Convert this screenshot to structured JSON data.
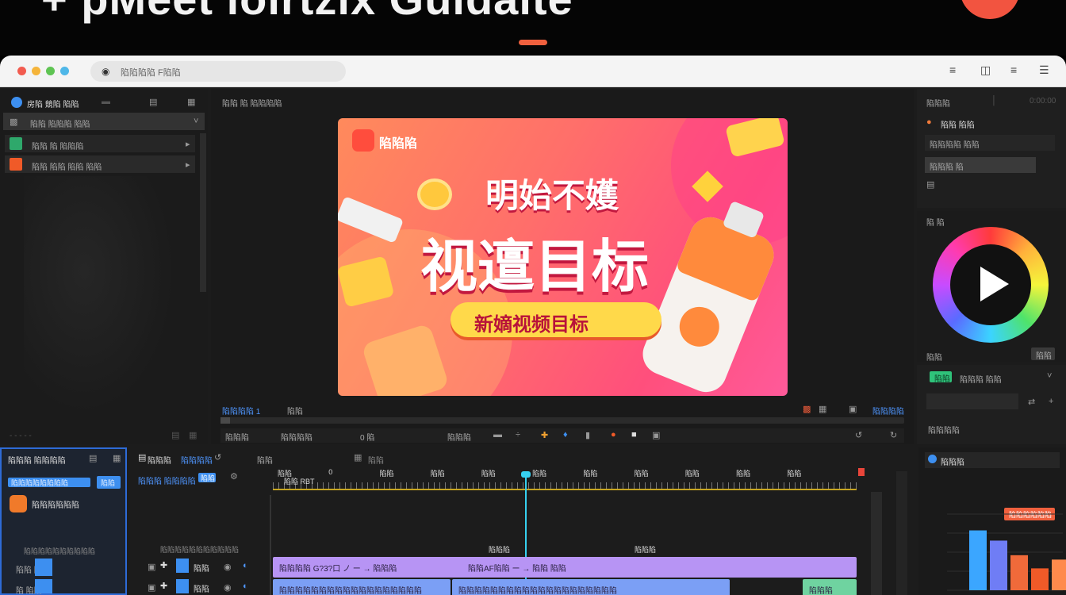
{
  "banner": {
    "title": "+ pMeet ioirtzix Guidaite"
  },
  "browser": {
    "url_text": "陷陷陷陷 F陷陷",
    "toolbar_icons": [
      "sliders-icon",
      "split-view-icon",
      "settings-icon",
      "menu-icon"
    ]
  },
  "media_panel": {
    "title": "房陷 競陷 陷陷",
    "folder_label": "陷陷 陷陷陷 陷陷",
    "items": [
      {
        "label": "陷陷 陷  陷陷陷",
        "color": "#2ea86b"
      },
      {
        "label": "陷陷 陷陷 陷陷 陷陷",
        "color": "#f05a28"
      }
    ],
    "footer": "-  -  -  -  -"
  },
  "viewer": {
    "header": "陷陷 陷 陷陷陷陷",
    "timecode": "陷陷陷陷  1",
    "timecode2": "陷陷",
    "ratio_label": "陷陷陷陷",
    "tools": [
      "陷陷陷",
      "陷陷陷陷",
      "0  陷",
      "陷陷陷"
    ],
    "preview": {
      "badge": "陷陷陷",
      "line1": "明始不嬳",
      "line2": "视邅目标",
      "line3": "新嫡视频目标"
    }
  },
  "inspector": {
    "header": "陷陷陷",
    "item_title": "陷陷 陷陷",
    "field1": "陷陷陷陷 陷陷",
    "field2": "陷陷陷 陷",
    "color_label": "陷 陷",
    "color_footer_left": "陷陷",
    "color_footer_right": "陷陷",
    "audio_tag": "陷陷",
    "audio_label": "陷陷陷 陷陷",
    "audio_footer": "陷陷陷陷"
  },
  "left_bottom": {
    "title": "陷陷陷  陷陷陷陷",
    "button": "陷陷陷陷陷陷陷陷",
    "button2": "陷陷",
    "item": "陷陷陷陷陷陷",
    "section": "陷陷陷陷陷陷陷陷陷陷",
    "row1": "陷陷 陷",
    "row2": "陷 陷陷"
  },
  "timeline": {
    "tabs": [
      "陷陷陷",
      "陷陷陷陷"
    ],
    "controls": "陷陷陷  陷陷陷陷",
    "control_badge": "陷陷",
    "ruler_labels": [
      "陷陷",
      "0",
      "陷陷",
      "陷陷",
      "陷陷",
      "陷陷",
      "陷陷",
      "陷陷",
      "陷陷",
      "陷陷",
      "陷陷"
    ],
    "ruler_sub": "陷陷 RBT",
    "track_label_top": "陷陷陷陷陷陷陷陷陷陷陷",
    "track1_name": "陷陷",
    "track2_name": "陷陷",
    "clip_top_label": "陷陷陷",
    "clip_top_label2": "陷陷陷",
    "clip_a": "陷陷陷陷 G?3?口 ノ ー → 陷陷陷",
    "clip_b": "陷陷AF陷陷 ー → 陷陷 陷陷",
    "clip_c": "陷陷陷陷陷陷陷陷陷陷陷陷陷陷陷陷陷陷",
    "clip_d": "陷陷陷陷陷陷陷陷陷陷陷陷陷陷陷陷陷陷陷陷",
    "clip_e": "陷陷陷"
  },
  "stats": {
    "title": "陷陷陷",
    "button": "陷陷陷陷陷陷",
    "chart_values": [
      0.82,
      0.68,
      0.48,
      0.3,
      0.42
    ]
  },
  "colors": {
    "accent": "#3d8ff0",
    "banner_orange": "#f0603e",
    "clip_purple": "#b794f4",
    "clip_blue": "#7b9ff5",
    "clip_green": "#6fd3a0"
  }
}
